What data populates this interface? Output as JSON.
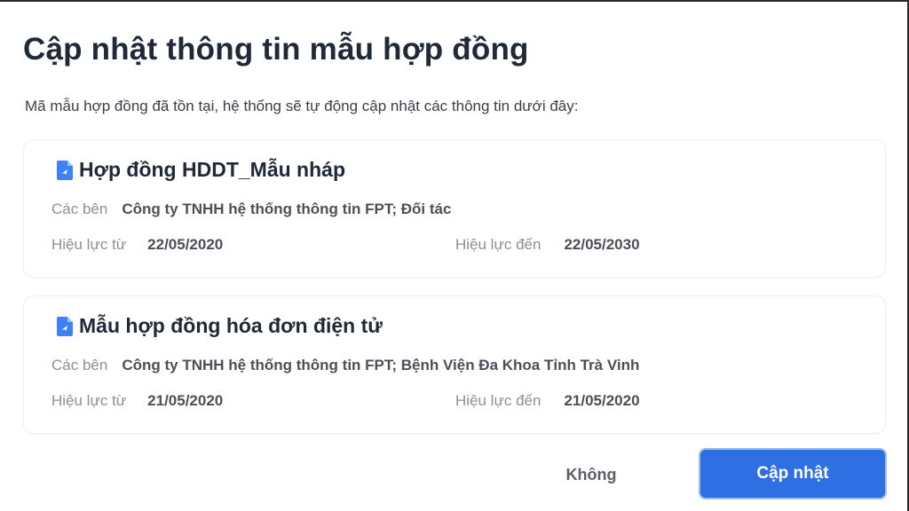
{
  "dialog": {
    "title": "Cập nhật thông tin mẫu hợp đồng",
    "subtitle": "Mã mẫu hợp đồng đã tồn tại, hệ thống sẽ tự động cập nhật các thông tin dưới đây:"
  },
  "contracts": [
    {
      "icon": "document-icon",
      "name": "Hợp đồng HDDT_Mẫu nháp",
      "parties_label": "Các bên",
      "parties": "Công ty TNHH hệ thống thông tin FPT; Đối tác",
      "from_label": "Hiệu lực từ",
      "from": "22/05/2020",
      "to_label": "Hiệu lực đến",
      "to": "22/05/2030"
    },
    {
      "icon": "document-icon",
      "name": "Mẫu hợp đồng hóa đơn điện tử",
      "parties_label": "Các bên",
      "parties": "Công ty TNHH hệ thống thông tin FPT; Bệnh Viện Đa Khoa Tỉnh Trà Vinh",
      "from_label": "Hiệu lực từ",
      "from": "21/05/2020",
      "to_label": "Hiệu lực đến",
      "to": "21/05/2020"
    }
  ],
  "actions": {
    "cancel_label": "Không",
    "confirm_label": "Cập nhật"
  },
  "colors": {
    "primary": "#2f6fe4",
    "icon": "#3b82f6"
  }
}
